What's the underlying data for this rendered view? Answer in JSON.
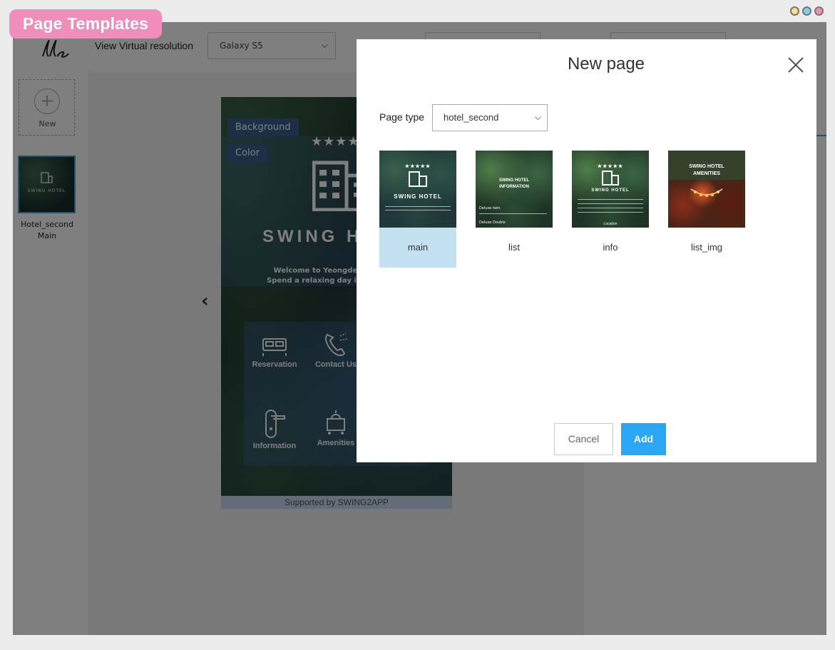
{
  "badge": {
    "label": "Page Templates"
  },
  "window": {
    "dot_colors": [
      "#f6df8f",
      "#7fd0e8",
      "#ef8dbb"
    ]
  },
  "header": {
    "resolution_label": "View Virtual resolution",
    "resolution_value": "Galaxy S5"
  },
  "left_panel": {
    "new_label": "New",
    "page_thumb_text": "SWING HOTEL",
    "page_name_line1": "Hotel_second",
    "page_name_line2": "Main"
  },
  "phone": {
    "chip_background": "Background",
    "chip_color": "Color",
    "stars": "★★★★★",
    "hotel_name": "SWING H",
    "welcome_line1": "Welcome to Yeongdeungpo Lan",
    "welcome_line2": "Spend a relaxing day in our stylish",
    "menu": [
      "Reservation",
      "Contact Us",
      "Information",
      "Amenities"
    ],
    "supported": "Supported by SWING2APP"
  },
  "modal": {
    "title": "New page",
    "page_type_label": "Page type",
    "page_type_value": "hotel_second",
    "templates": [
      {
        "label": "main",
        "selected": true,
        "caption": "SWING HOTEL"
      },
      {
        "label": "list",
        "selected": false,
        "caption": "SWING HOTEL INFORMATION",
        "row1": "Deluxe twin",
        "row2": "Deluxe Double"
      },
      {
        "label": "info",
        "selected": false,
        "caption": "SWING HOTEL",
        "footer": "Location"
      },
      {
        "label": "list_img",
        "selected": false,
        "caption": "SWING HOTEL AMENITIES"
      }
    ],
    "cancel_label": "Cancel",
    "add_label": "Add"
  },
  "colors": {
    "accent": "#2aa6f4",
    "selected_bg": "#c4e1f2",
    "badge": "#ef8dbb"
  }
}
